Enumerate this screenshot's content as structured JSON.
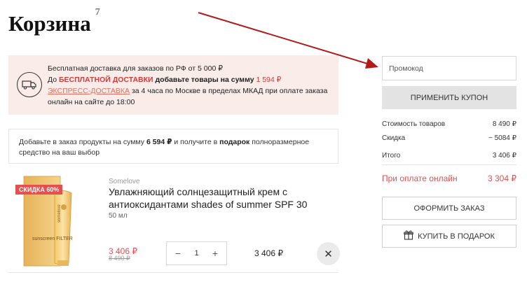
{
  "page": {
    "title": "Корзина",
    "item_count": "7"
  },
  "delivery": {
    "line1": "Бесплатная доставка для заказов по РФ от 5 000 ₽",
    "line2_prefix": "До ",
    "line2_red": "БЕСПЛАТНОЙ ДОСТАВКИ",
    "line2_bold": " добавьте товары на сумму ",
    "line2_amount": "1 594 ₽",
    "express_link": "ЭКСПРЕСС-ДОСТАВКА",
    "line3_rest": " за 4 часа по Москве в пределах МКАД при оплате заказа",
    "line4": "онлайн на сайте до 18:00",
    "icon": "truck-icon"
  },
  "gift_notice": {
    "prefix": "Добавьте в заказ продукты на сумму ",
    "amount": "6 594 ₽",
    "middle": " и получите в ",
    "gift_word": "подарок",
    "suffix": " полноразмерное средство на ваш выбор"
  },
  "product": {
    "badge": "СКИДКА 60%",
    "brand": "Somelove",
    "name": "Увлажняющий солнцезащитный крем с антиоксидантами shades of summer SPF 30",
    "volume": "50 мл",
    "price": "3 406 ₽",
    "old_price": "8 490 ₽",
    "quantity": "1",
    "minus": "−",
    "plus": "+",
    "line_total": "3 406 ₽",
    "remove": "✕",
    "tube_brand": "somelove",
    "tube_name": "sunscreen FILTER"
  },
  "sidebar": {
    "promo_placeholder": "Промокод",
    "apply_label": "ПРИМЕНИТЬ КУПОН",
    "goods_label": "Стоимость товаров",
    "goods_value": "8 490 ₽",
    "discount_label": "Скидка",
    "discount_value": "− 5084 ₽",
    "total_label": "Итого",
    "total_value": "3 406 ₽",
    "online_label": "При оплате онлайн",
    "online_value": "3 304 ₽",
    "checkout_label": "ОФОРМИТЬ ЗАКАЗ",
    "gift_buy_label": "КУПИТЬ В ПОДАРОК",
    "gift_icon": "gift-icon"
  },
  "colors": {
    "accent_red": "#e44f4f",
    "delivery_bg": "#f9ece9",
    "annotation_arrow": "#b01c1c"
  }
}
